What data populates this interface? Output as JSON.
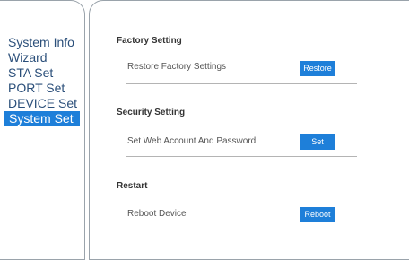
{
  "sidebar": {
    "items": [
      {
        "label": "System Info"
      },
      {
        "label": "Wizard"
      },
      {
        "label": "STA Set"
      },
      {
        "label": "PORT Set"
      },
      {
        "label": "DEVICE Set"
      },
      {
        "label": "System Set",
        "active": true
      }
    ]
  },
  "sections": {
    "factory": {
      "title": "Factory Setting",
      "row_label": "Restore Factory Settings",
      "button_label": "Restore"
    },
    "security": {
      "title": "Security Setting",
      "row_label": "Set Web Account And Password",
      "button_label": "Set"
    },
    "restart": {
      "title": "Restart",
      "row_label": "Reboot Device",
      "button_label": "Reboot"
    }
  },
  "colors": {
    "accent": "#1e7fd9",
    "sidebar_text": "#2b4f7a",
    "border": "#9aa3ab"
  }
}
